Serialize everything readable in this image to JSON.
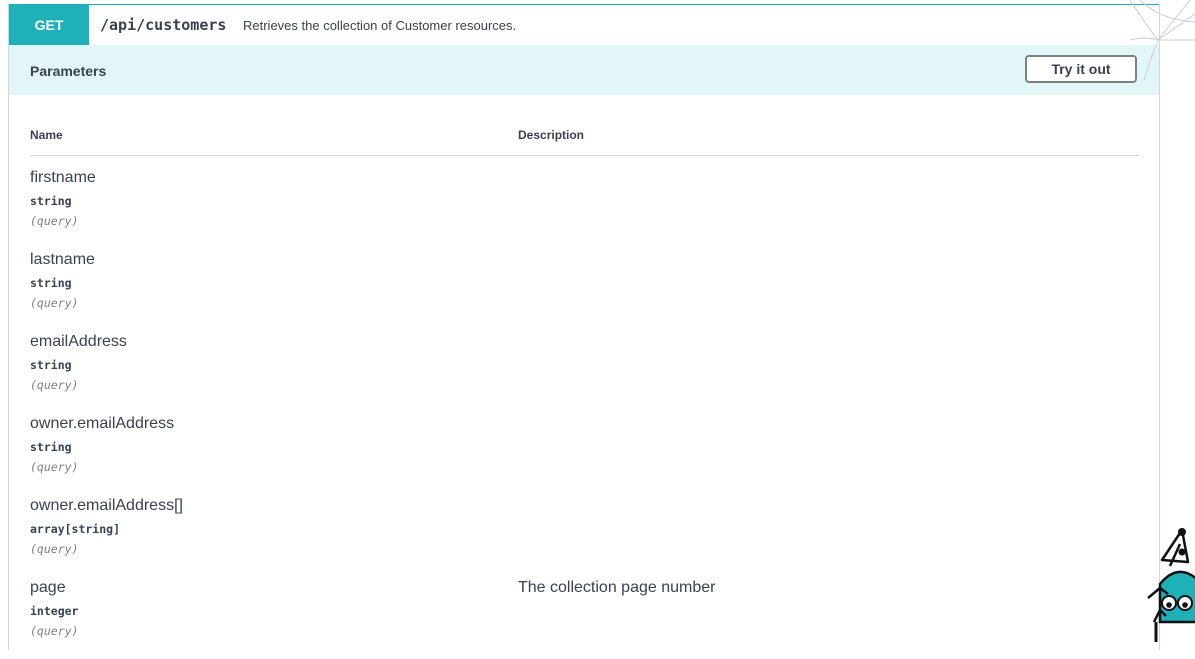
{
  "operation": {
    "method": "GET",
    "path": "/api/customers",
    "summary": "Retrieves the collection of Customer resources."
  },
  "parameters_section": {
    "title": "Parameters",
    "try_button_label": "Try it out",
    "columns": {
      "name": "Name",
      "description": "Description"
    },
    "params": [
      {
        "name": "firstname",
        "type": "string",
        "in": "(query)",
        "description": ""
      },
      {
        "name": "lastname",
        "type": "string",
        "in": "(query)",
        "description": ""
      },
      {
        "name": "emailAddress",
        "type": "string",
        "in": "(query)",
        "description": ""
      },
      {
        "name": "owner.emailAddress",
        "type": "string",
        "in": "(query)",
        "description": ""
      },
      {
        "name": "owner.emailAddress[]",
        "type": "array[string]",
        "in": "(query)",
        "description": ""
      },
      {
        "name": "page",
        "type": "integer",
        "in": "(query)",
        "description": "The collection page number"
      }
    ]
  },
  "colors": {
    "get_accent": "#1fb0b8",
    "param_header_bg": "#e2f6f7"
  },
  "icons": {
    "decoration": "spider-web-icon",
    "mascot": "spider-mascot-icon"
  }
}
